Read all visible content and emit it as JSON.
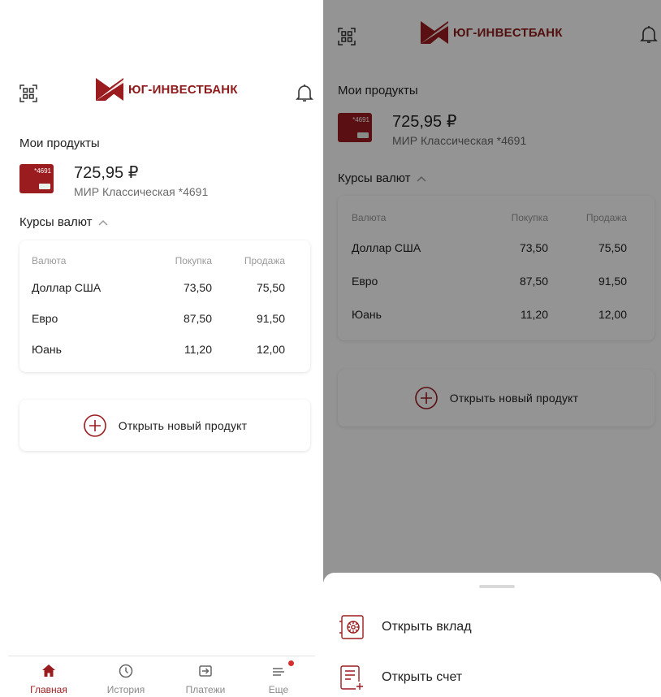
{
  "brand": {
    "name": "ЮГ-ИНВЕСТБАНК",
    "accent": "#9b1c1f"
  },
  "products": {
    "title": "Мои продукты",
    "card_number": "*4691",
    "amount": "725,95 ₽",
    "name": "МИР Классическая *4691"
  },
  "rates": {
    "title": "Курсы валют",
    "headers": {
      "currency": "Валюта",
      "buy": "Покупка",
      "sell": "Продажа"
    },
    "rows": [
      {
        "currency": "Доллар США",
        "buy": "73,50",
        "sell": "75,50"
      },
      {
        "currency": "Евро",
        "buy": "87,50",
        "sell": "91,50"
      },
      {
        "currency": "Юань",
        "buy": "11,20",
        "sell": "12,00"
      }
    ]
  },
  "open_product": {
    "label": "Открыть новый продукт",
    "icon": "plus-circle-icon"
  },
  "nav": {
    "items": [
      {
        "label": "Главная",
        "icon": "home-icon",
        "active": true
      },
      {
        "label": "История",
        "icon": "clock-icon",
        "active": false
      },
      {
        "label": "Платежи",
        "icon": "payments-icon",
        "active": false
      },
      {
        "label": "Еще",
        "icon": "menu-icon",
        "active": false,
        "badge": true
      }
    ]
  },
  "sheet": {
    "items": [
      {
        "label": "Открыть вклад",
        "icon": "safe-icon"
      },
      {
        "label": "Открыть счет",
        "icon": "document-add-icon"
      }
    ]
  }
}
